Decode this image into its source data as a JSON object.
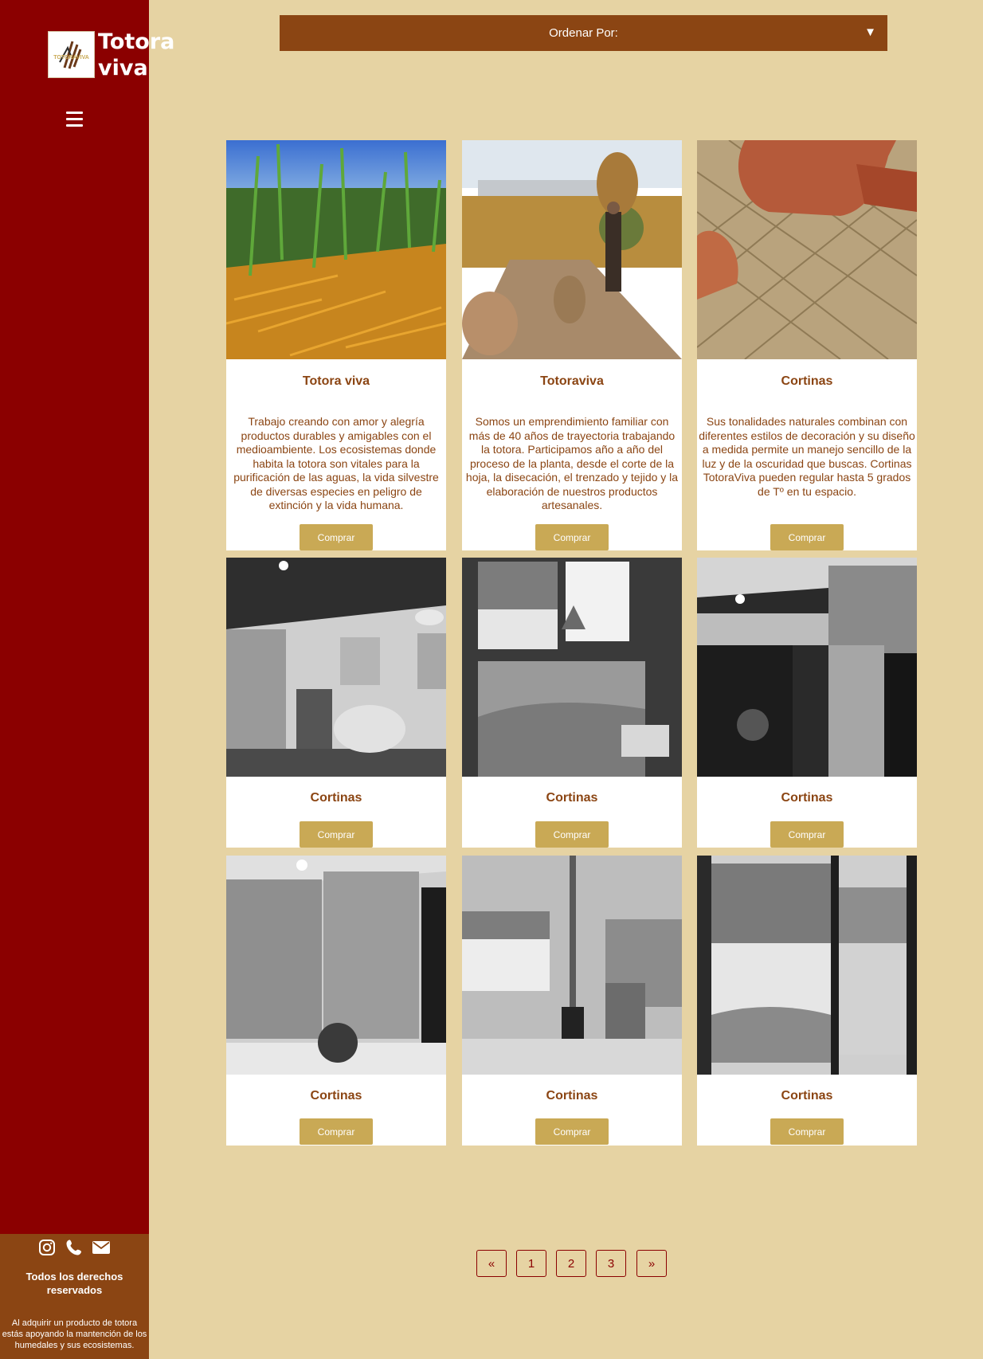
{
  "brand": {
    "name": "Totora viva",
    "logo_text": "TOTORAVIVA"
  },
  "sort": {
    "label": "Ordenar Por:",
    "arrow": "▼"
  },
  "products": [
    {
      "title": "Totora viva",
      "description": "Trabajo creando con amor y alegría productos durables y amigables con el medioambiente. Los ecosistemas donde habita la totora son vitales para la purificación de las aguas, la vida silvestre de diversas especies en peligro de extinción y la vida humana.",
      "button": "Comprar"
    },
    {
      "title": "Totoraviva",
      "description": "Somos un emprendimiento familiar con más de 40 años de trayectoria trabajando la totora. Participamos año a año del proceso de la planta, desde el corte de la hoja, la disecación, el trenzado y tejido y la elaboración de nuestros productos artesanales.",
      "button": "Comprar"
    },
    {
      "title": "Cortinas",
      "description": "Sus tonalidades naturales combinan con diferentes estilos de decoración y su diseño a medida permite un manejo sencillo de la luz y de la oscuridad que buscas. Cortinas TotoraViva pueden regular hasta 5 grados de Tº en tu espacio.",
      "button": "Comprar"
    },
    {
      "title": "Cortinas",
      "button": "Comprar"
    },
    {
      "title": "Cortinas",
      "button": "Comprar"
    },
    {
      "title": "Cortinas",
      "button": "Comprar"
    },
    {
      "title": "Cortinas",
      "button": "Comprar"
    },
    {
      "title": "Cortinas",
      "button": "Comprar"
    },
    {
      "title": "Cortinas",
      "button": "Comprar"
    }
  ],
  "pagination": {
    "prev": "«",
    "pages": [
      "1",
      "2",
      "3"
    ],
    "next": "»"
  },
  "footer": {
    "rights": "Todos los derechos reservados",
    "note": "Al adquirir un producto de totora estás apoyando la mantención de los humedales y sus ecosistemas."
  },
  "colors": {
    "sidebar": "#8b0000",
    "accent": "#8b4513",
    "background": "#e6d3a3",
    "button": "#c9a955"
  }
}
